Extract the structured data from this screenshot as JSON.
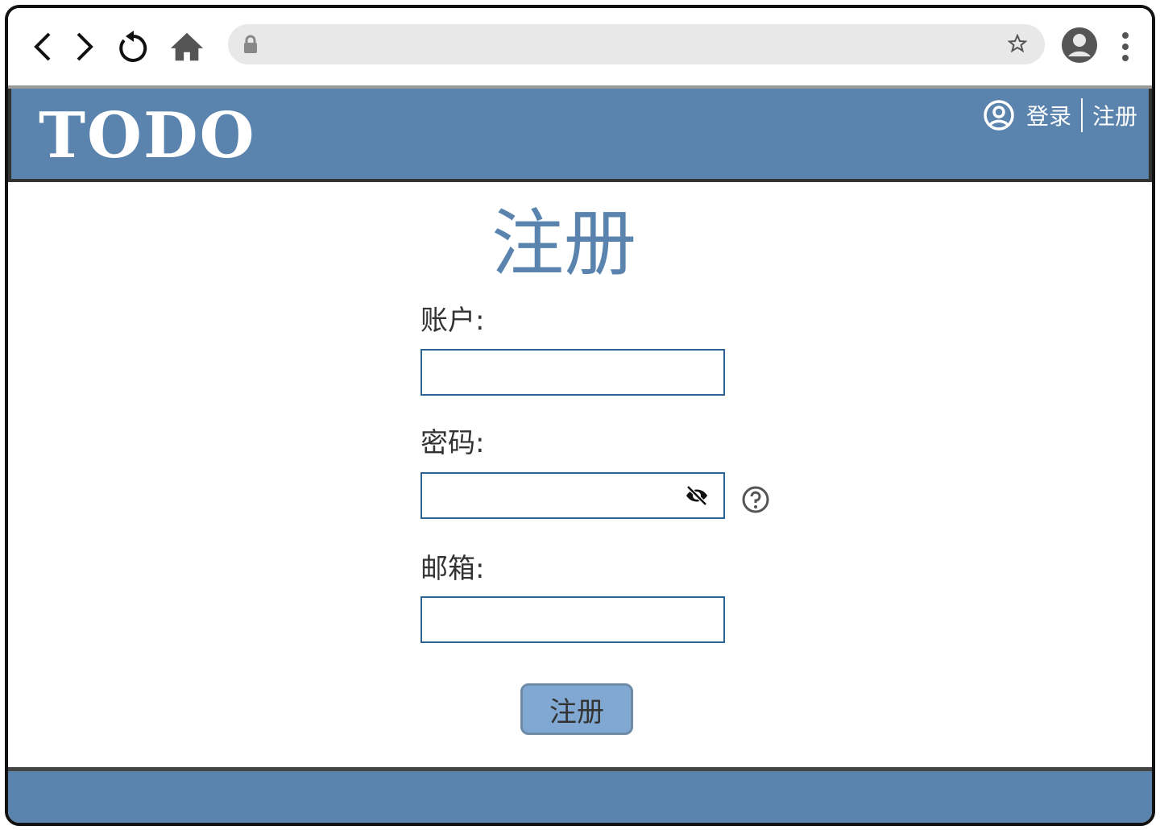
{
  "browser": {
    "url": "",
    "icons": [
      "back-icon",
      "forward-icon",
      "reload-icon",
      "home-icon",
      "lock-icon",
      "star-icon",
      "profile-icon",
      "menu-icon"
    ]
  },
  "header": {
    "logo": "TODO",
    "login": "登录",
    "register": "注册"
  },
  "form": {
    "title": "注册",
    "account_label": "账户:",
    "password_label": "密码:",
    "email_label": "邮箱:",
    "account_value": "",
    "password_value": "",
    "email_value": "",
    "submit": "注册"
  },
  "colors": {
    "primary": "#5a84ae",
    "button": "#80a8d2",
    "field_border": "#2d6494"
  }
}
